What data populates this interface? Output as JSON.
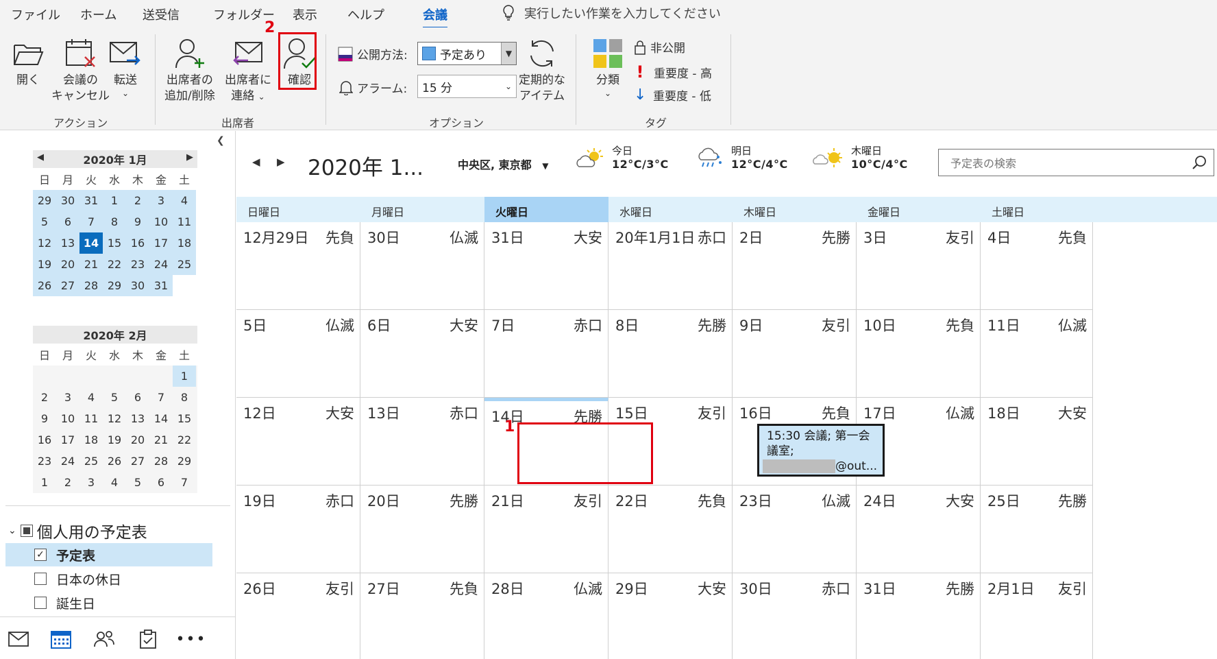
{
  "menu": {
    "tabs": [
      "ファイル",
      "ホーム",
      "送受信",
      "フォルダー",
      "表示",
      "ヘルプ",
      "会議"
    ],
    "active_tab": "会議",
    "tell_me": "実行したい作業を入力してください"
  },
  "ribbon": {
    "actions": {
      "open": "開く",
      "cancel_line1": "会議の",
      "cancel_line2": "キャンセル",
      "forward": "転送",
      "group_label": "アクション"
    },
    "attendees": {
      "add_remove_line1": "出席者の",
      "add_remove_line2": "追加/削除",
      "contact_line1": "出席者に",
      "contact_line2": "連絡",
      "confirm": "確認",
      "group_label": "出席者"
    },
    "options": {
      "show_as_label": "公開方法:",
      "show_as_value": "予定あり",
      "reminder_label": "アラーム:",
      "reminder_value": "15 分",
      "recurrence_line1": "定期的な",
      "recurrence_line2": "アイテム",
      "group_label": "オプション"
    },
    "tags": {
      "categorize": "分類",
      "private": "非公開",
      "high": "重要度 - 高",
      "low": "重要度 - 低",
      "group_label": "タグ"
    },
    "annotation_2": "2",
    "annotation_1": "1"
  },
  "mini_calendars": [
    {
      "title": "2020年 1月",
      "dow": [
        "日",
        "月",
        "火",
        "水",
        "木",
        "金",
        "土"
      ],
      "days": [
        "29",
        "30",
        "31",
        "1",
        "2",
        "3",
        "4",
        "5",
        "6",
        "7",
        "8",
        "9",
        "10",
        "11",
        "12",
        "13",
        "14",
        "15",
        "16",
        "17",
        "18",
        "19",
        "20",
        "21",
        "22",
        "23",
        "24",
        "25",
        "26",
        "27",
        "28",
        "29",
        "30",
        "31",
        ""
      ],
      "today": "14"
    },
    {
      "title": "2020年 2月",
      "dow": [
        "日",
        "月",
        "火",
        "水",
        "木",
        "金",
        "土"
      ],
      "days": [
        "",
        "",
        "",
        "",
        "",
        "",
        "1",
        "2",
        "3",
        "4",
        "5",
        "6",
        "7",
        "8",
        "9",
        "10",
        "11",
        "12",
        "13",
        "14",
        "15",
        "16",
        "17",
        "18",
        "19",
        "20",
        "21",
        "22",
        "23",
        "24",
        "25",
        "26",
        "27",
        "28",
        "29",
        "1",
        "2",
        "3",
        "4",
        "5",
        "6",
        "7"
      ]
    }
  ],
  "folders": {
    "group": "個人用の予定表",
    "items": [
      {
        "label": "予定表",
        "checked": true
      },
      {
        "label": "日本の休日",
        "checked": false
      },
      {
        "label": "誕生日",
        "checked": false
      }
    ]
  },
  "calendar": {
    "range_title": "2020年 1...",
    "location": "中央区, 東京都",
    "weather": [
      {
        "label": "今日",
        "temp": "12°C/3°C",
        "icon": "partly-sunny-icon"
      },
      {
        "label": "明日",
        "temp": "12°C/4°C",
        "icon": "snow-rain-icon"
      },
      {
        "label": "木曜日",
        "temp": "10°C/4°C",
        "icon": "sunny-cloud-icon"
      }
    ],
    "search_placeholder": "予定表の検索",
    "dow": [
      "日曜日",
      "月曜日",
      "火曜日",
      "水曜日",
      "木曜日",
      "金曜日",
      "土曜日"
    ],
    "weeks": [
      [
        [
          "12月29日",
          "先負"
        ],
        [
          "30日",
          "仏滅"
        ],
        [
          "31日",
          "大安"
        ],
        [
          "20年1月1日",
          "赤口"
        ],
        [
          "2日",
          "先勝"
        ],
        [
          "3日",
          "友引"
        ],
        [
          "4日",
          "先負"
        ]
      ],
      [
        [
          "5日",
          "仏滅"
        ],
        [
          "6日",
          "大安"
        ],
        [
          "7日",
          "赤口"
        ],
        [
          "8日",
          "先勝"
        ],
        [
          "9日",
          "友引"
        ],
        [
          "10日",
          "先負"
        ],
        [
          "11日",
          "仏滅"
        ]
      ],
      [
        [
          "12日",
          "大安"
        ],
        [
          "13日",
          "赤口"
        ],
        [
          "14日",
          "先勝"
        ],
        [
          "15日",
          "友引"
        ],
        [
          "16日",
          "先負"
        ],
        [
          "17日",
          "仏滅"
        ],
        [
          "18日",
          "大安"
        ]
      ],
      [
        [
          "19日",
          "赤口"
        ],
        [
          "20日",
          "先勝"
        ],
        [
          "21日",
          "友引"
        ],
        [
          "22日",
          "先負"
        ],
        [
          "23日",
          "仏滅"
        ],
        [
          "24日",
          "大安"
        ],
        [
          "25日",
          "先勝"
        ]
      ],
      [
        [
          "26日",
          "友引"
        ],
        [
          "27日",
          "先負"
        ],
        [
          "28日",
          "仏滅"
        ],
        [
          "29日",
          "大安"
        ],
        [
          "30日",
          "赤口"
        ],
        [
          "31日",
          "先勝"
        ],
        [
          "2月1日",
          "友引"
        ]
      ]
    ],
    "appointment": {
      "line1": "15:30 会議; 第一会",
      "line2": "議室;",
      "line3_suffix": "@out..."
    }
  },
  "colors": {
    "accent": "#0f64c8",
    "selection": "#cde6f7",
    "today_header": "#a9d4f5",
    "annotation_red": "#e00010"
  }
}
